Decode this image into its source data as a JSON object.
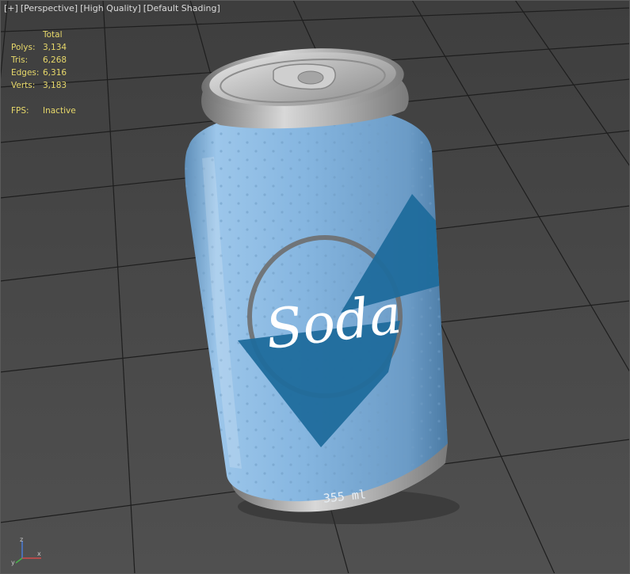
{
  "viewport": {
    "labels": [
      "[+]",
      "[Perspective]",
      "[High Quality]",
      "[Default Shading]"
    ],
    "stats": {
      "header": "Total",
      "rows": [
        {
          "label": "Polys:",
          "value": "3,134"
        },
        {
          "label": "Tris:",
          "value": "6,268"
        },
        {
          "label": "Edges:",
          "value": "6,316"
        },
        {
          "label": "Verts:",
          "value": "3,183"
        }
      ],
      "fps_label": "FPS:",
      "fps_value": "Inactive"
    },
    "stats_color": "#e7d86a",
    "background_color": "#464646",
    "grid_color": "#1e1e1e"
  },
  "model": {
    "brand": "Soda",
    "volume": "355 ml",
    "can_color": "#86b6e0",
    "accent_color": "#1f6b9c"
  },
  "axis": {
    "z_label": "z",
    "x_label": "x",
    "y_label": "y"
  }
}
